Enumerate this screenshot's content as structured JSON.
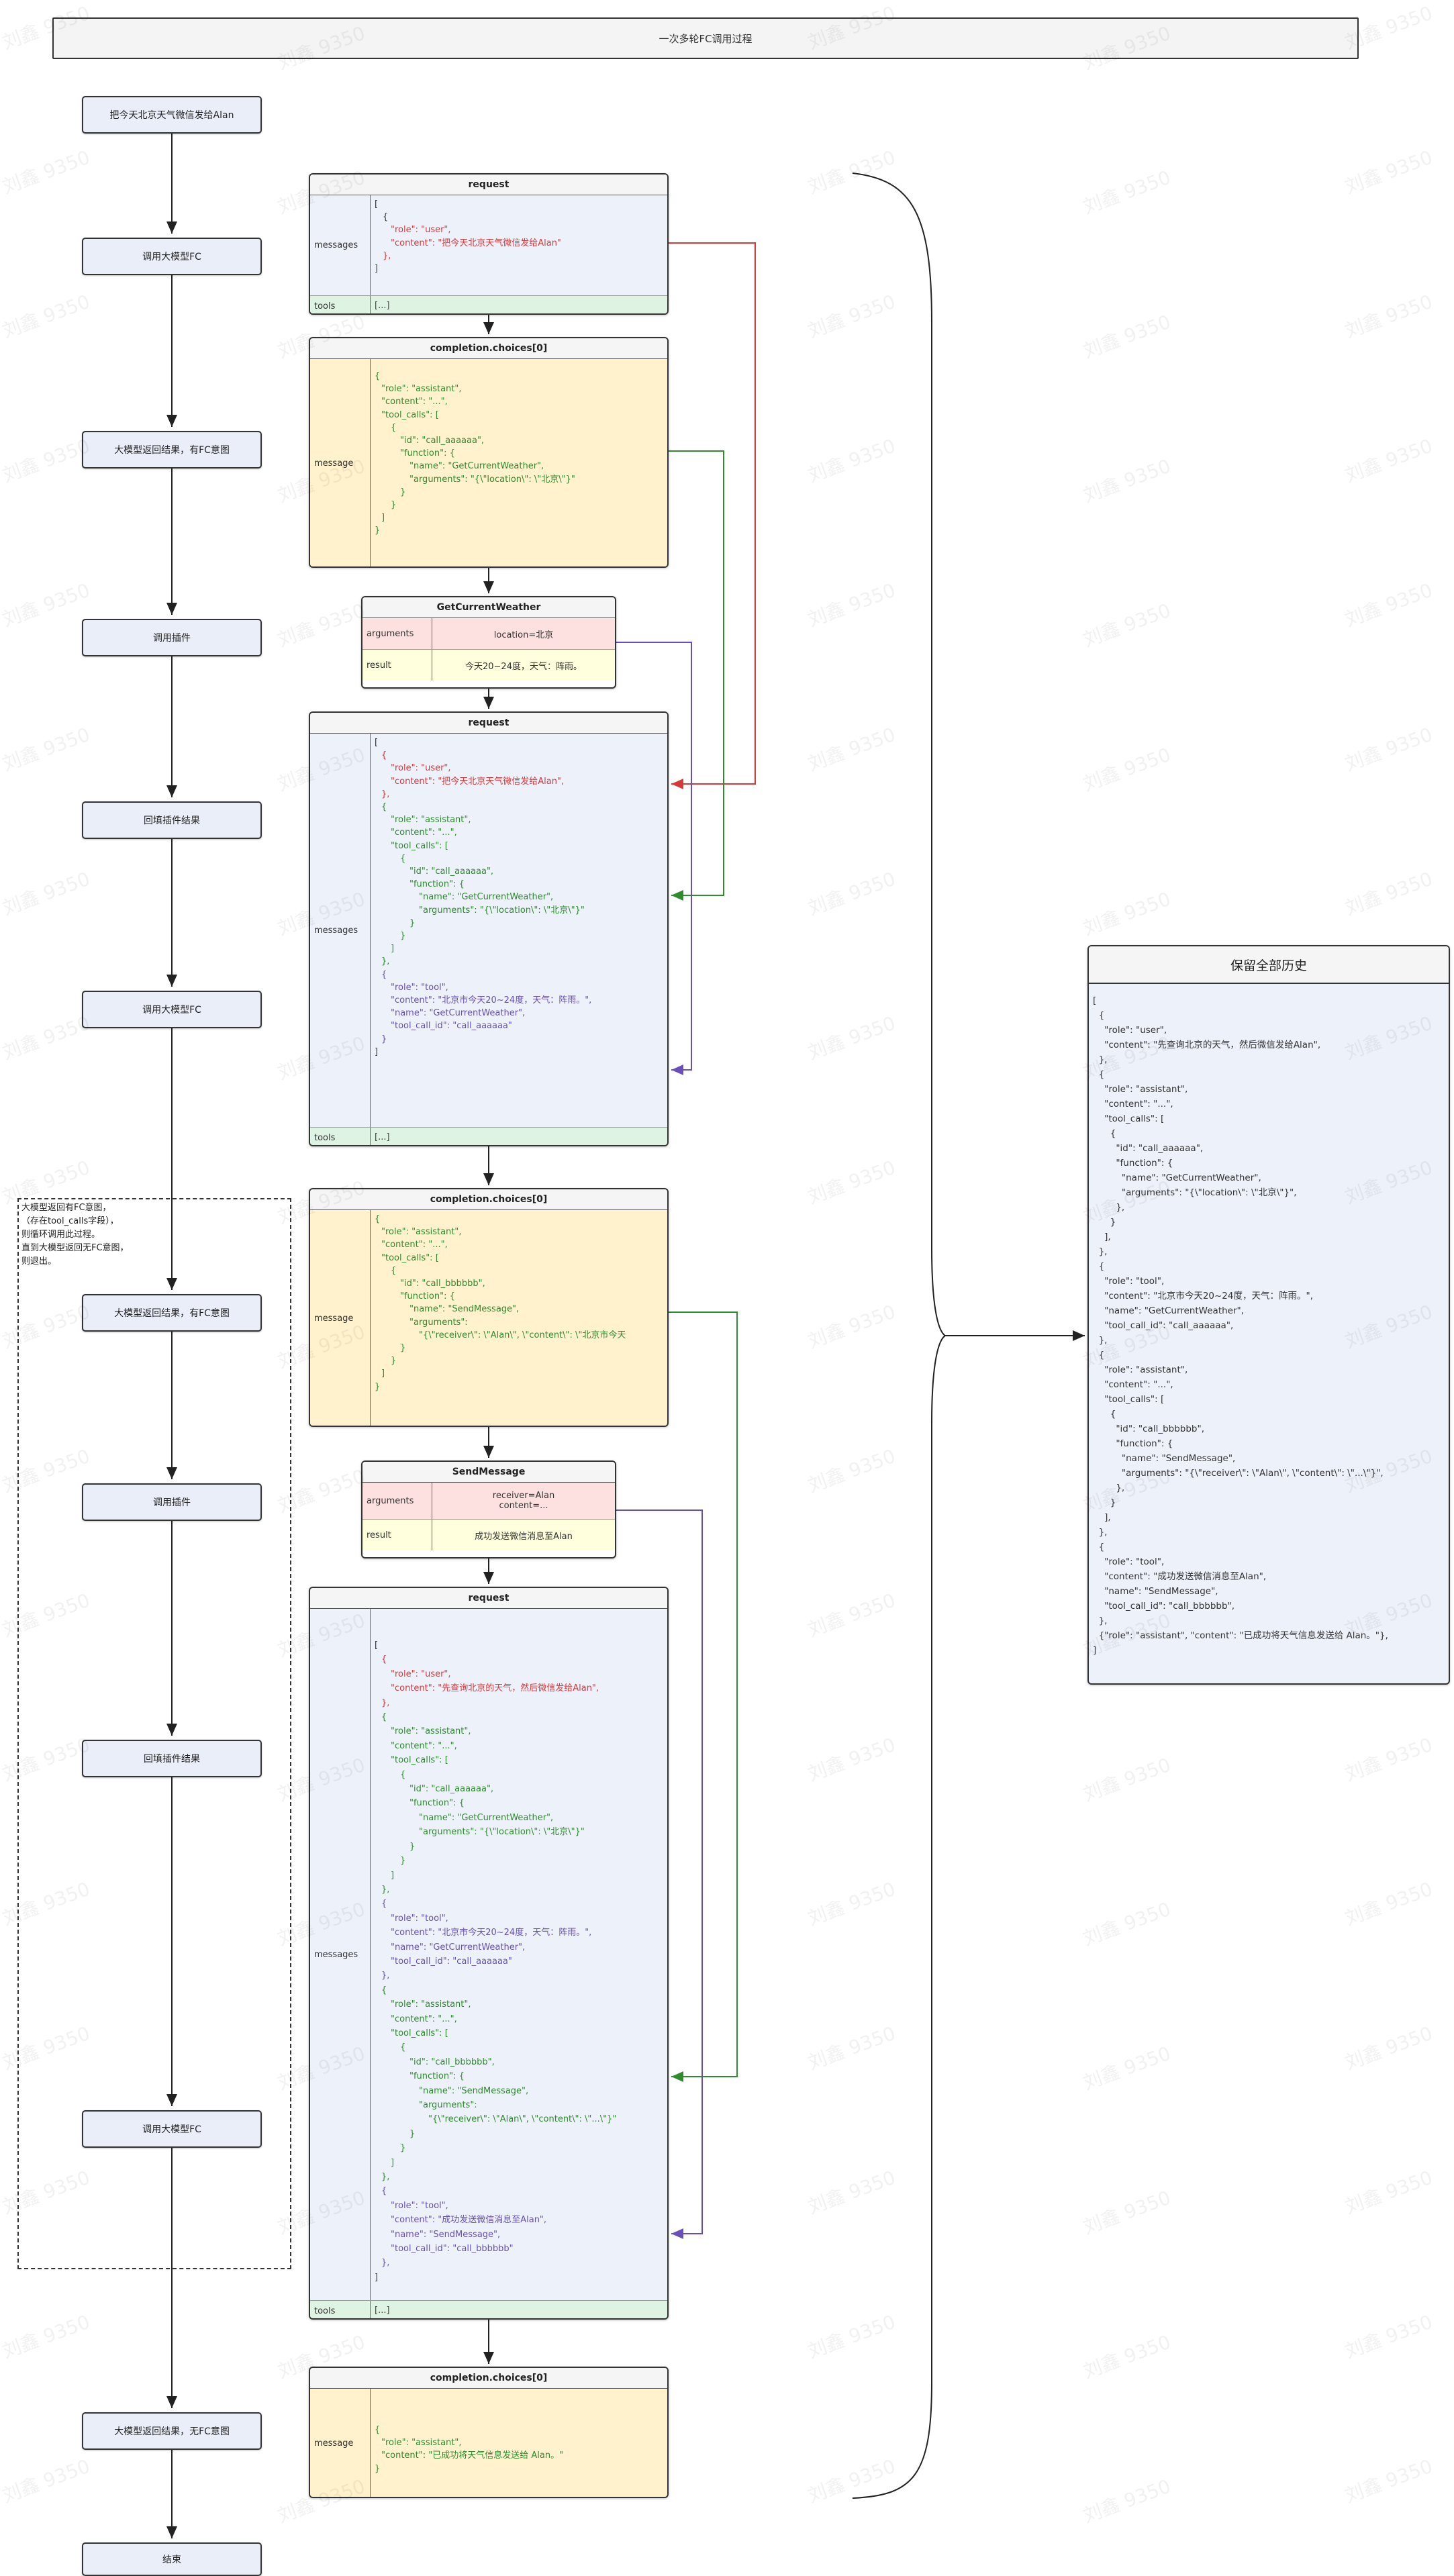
{
  "title": "一次多轮FC调用过程",
  "watermark": "刘鑫 9350",
  "steps": {
    "s1": "把今天北京天气微信发给Alan",
    "s2": "调用大模型FC",
    "s3": "大模型返回结果，有FC意图",
    "s4": "调用插件",
    "s5": "回填插件结果",
    "s6": "调用大模型FC",
    "s7": "大模型返回结果，有FC意图",
    "s8": "调用插件",
    "s9": "回填插件结果",
    "s10": "调用大模型FC",
    "s11": "大模型返回结果，无FC意图",
    "s12": "结束"
  },
  "loop_note": "大模型返回有FC意图，\n（存在tool_calls字段），\n则循环调用此过程。\n直到大模型返回无FC意图，\n则退出。",
  "labels": {
    "request": "request",
    "completion": "completion.choices[0]",
    "messages": "messages",
    "message": "message",
    "tools": "tools",
    "tools_value": "[...]",
    "arguments": "arguments",
    "result": "result"
  },
  "plugin1": {
    "name": "GetCurrentWeather",
    "arguments": "location=北京",
    "result": "今天20~24度，天气：阵雨。"
  },
  "plugin2": {
    "name": "SendMessage",
    "arguments_l1": "receiver=Alan",
    "arguments_l2": "content=...",
    "result": "成功发送微信消息至Alan"
  },
  "history": {
    "title": "保留全部历史",
    "content": "[\n  {\n    \"role\": \"user\",\n    \"content\": \"先查询北京的天气，然后微信发给Alan\",\n  },\n  {\n    \"role\": \"assistant\",\n    \"content\": \"...\",\n    \"tool_calls\": [\n      {\n        \"id\": \"call_aaaaaa\",\n        \"function\": {\n          \"name\": \"GetCurrentWeather\",\n          \"arguments\": \"{\\\"location\\\": \\\"北京\\\"}\",\n        },\n      }\n    ],\n  },\n  {\n    \"role\": \"tool\",\n    \"content\": \"北京市今天20~24度，天气：阵雨。\",\n    \"name\": \"GetCurrentWeather\",\n    \"tool_call_id\": \"call_aaaaaa\",\n  },\n  {\n    \"role\": \"assistant\",\n    \"content\": \"...\",\n    \"tool_calls\": [\n      {\n        \"id\": \"call_bbbbbb\",\n        \"function\": {\n          \"name\": \"SendMessage\",\n          \"arguments\": \"{\\\"receiver\\\": \\\"Alan\\\", \\\"content\\\": \\\"...\\\"}\",\n        },\n      }\n    ],\n  },\n  {\n    \"role\": \"tool\",\n    \"content\": \"成功发送微信消息至Alan\",\n    \"name\": \"SendMessage\",\n    \"tool_call_id\": \"call_bbbbbb\",\n  },\n  {\"role\": \"assistant\", \"content\": \"已成功将天气信息发送给 Alan。\"},\n]"
  },
  "code": {
    "bracket_open": "[",
    "bracket_close": "]",
    "brace_open": "{",
    "brace_close": "}",
    "brace_close_comma": "},",
    "list_close": "]",
    "role_user": "\"role\": \"user\",",
    "role_assistant": "\"role\": \"assistant\",",
    "role_tool": "\"role\": \"tool\",",
    "content_user1": "\"content\": \"把今天北京天气微信发给Alan\"",
    "content_user1c": "\"content\": \"把今天北京天气微信发给Alan\",",
    "content_user2": "\"content\": \"先查询北京的天气，然后微信发给Alan\",",
    "content_dots": "\"content\": \"...\",",
    "tool_calls": "\"tool_calls\": [",
    "id_a": "\"id\": \"call_aaaaaa\",",
    "id_b": "\"id\": \"call_bbbbbb\",",
    "function": "\"function\": {",
    "name_weather": "\"name\": \"GetCurrentWeather\"",
    "name_weather_c": "\"name\": \"GetCurrentWeather\",",
    "args_weather": "\"arguments\": \"{\\\"location\\\": \\\"北京\\\"}\"",
    "name_send": "\"name\": \"SendMessage\",",
    "args_label": "\"arguments\":",
    "args_send_long": "\"{\\\"receiver\\\": \\\"Alan\\\", \\\"content\\\": \\\"北京市今天",
    "args_send_short": "\"{\\\"receiver\\\": \\\"Alan\\\", \\\"content\\\": \\\"...\\\"}\"",
    "tool_content_a": "\"content\": \"北京市今天20~24度，天气：阵雨。\",",
    "tool_call_id_a": "\"tool_call_id\": \"call_aaaaaa\"",
    "tool_content_b": "\"content\": \"成功发送微信消息至Alan\",",
    "tool_name_send": "\"name\": \"SendMessage\",",
    "tool_call_id_b": "\"tool_call_id\": \"call_bbbbbb\"",
    "final_content": "\"content\": \"已成功将天气信息发送给 Alan。\""
  }
}
